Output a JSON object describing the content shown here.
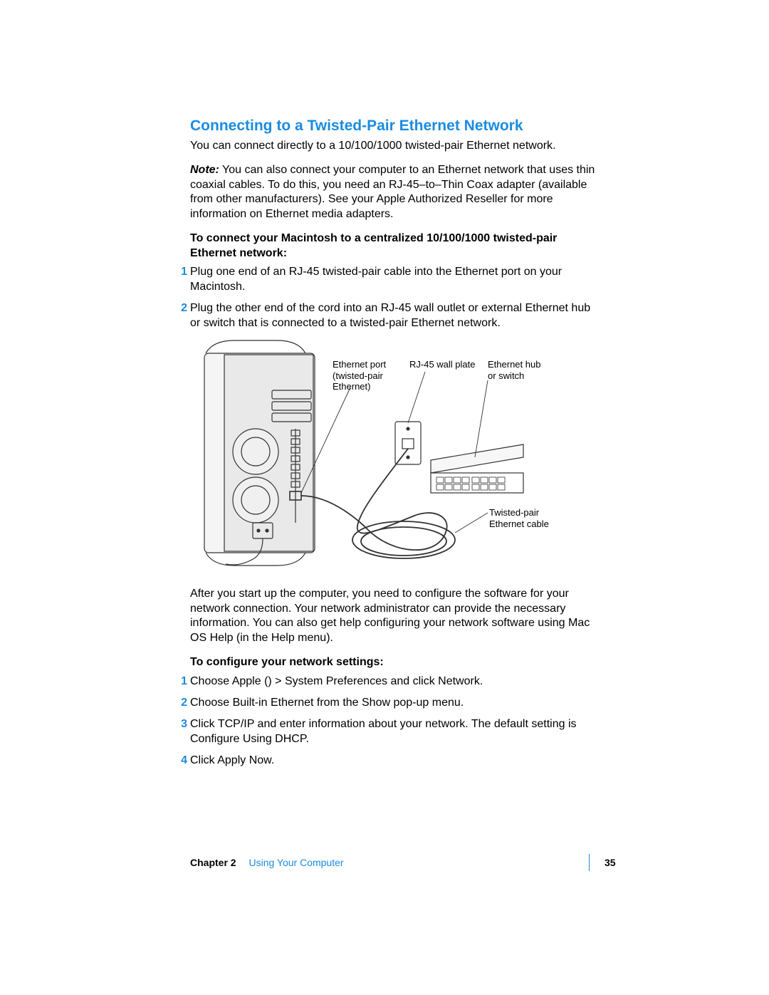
{
  "heading": "Connecting to a Twisted-Pair Ethernet Network",
  "intro": "You can connect directly to a 10/100/1000 twisted-pair Ethernet network.",
  "note": {
    "label": "Note:",
    "text": "You can also connect your computer to an Ethernet network that uses thin coaxial cables. To do this, you need an RJ-45–to–Thin Coax adapter (available from other manufacturers). See your Apple Authorized Reseller for more information on Ethernet media adapters."
  },
  "subhead1": "To connect your Macintosh to a centralized 10/100/1000 twisted-pair Ethernet network:",
  "steps1": [
    "Plug one end of an RJ-45 twisted-pair cable into the Ethernet port on your Macintosh.",
    "Plug the other end of the cord into an RJ-45 wall outlet or external Ethernet hub or switch that is connected to a twisted-pair Ethernet network."
  ],
  "diagram_labels": {
    "ethernet_port": "Ethernet port\n(twisted-pair\nEthernet)",
    "wall_plate": "RJ-45 wall plate",
    "hub": "Ethernet hub\nor switch",
    "cable": "Twisted-pair\nEthernet cable"
  },
  "after_diagram": "After you start up the computer, you need to configure the software for your network connection. Your network administrator can provide the necessary information. You can also get help configuring your network software using Mac OS Help (in the Help menu).",
  "subhead2": "To configure your network settings:",
  "steps2_prefix": "Choose Apple (",
  "steps2_glyph": "",
  "steps2_suffix": ") > System Preferences and click Network.",
  "steps2_rest": [
    "Choose Built-in Ethernet from the Show pop-up menu.",
    "Click TCP/IP and enter information about your network. The default setting is Configure Using DHCP.",
    "Click Apply Now."
  ],
  "footer": {
    "chapter_label": "Chapter 2",
    "chapter_title": "Using Your Computer",
    "page": "35"
  }
}
